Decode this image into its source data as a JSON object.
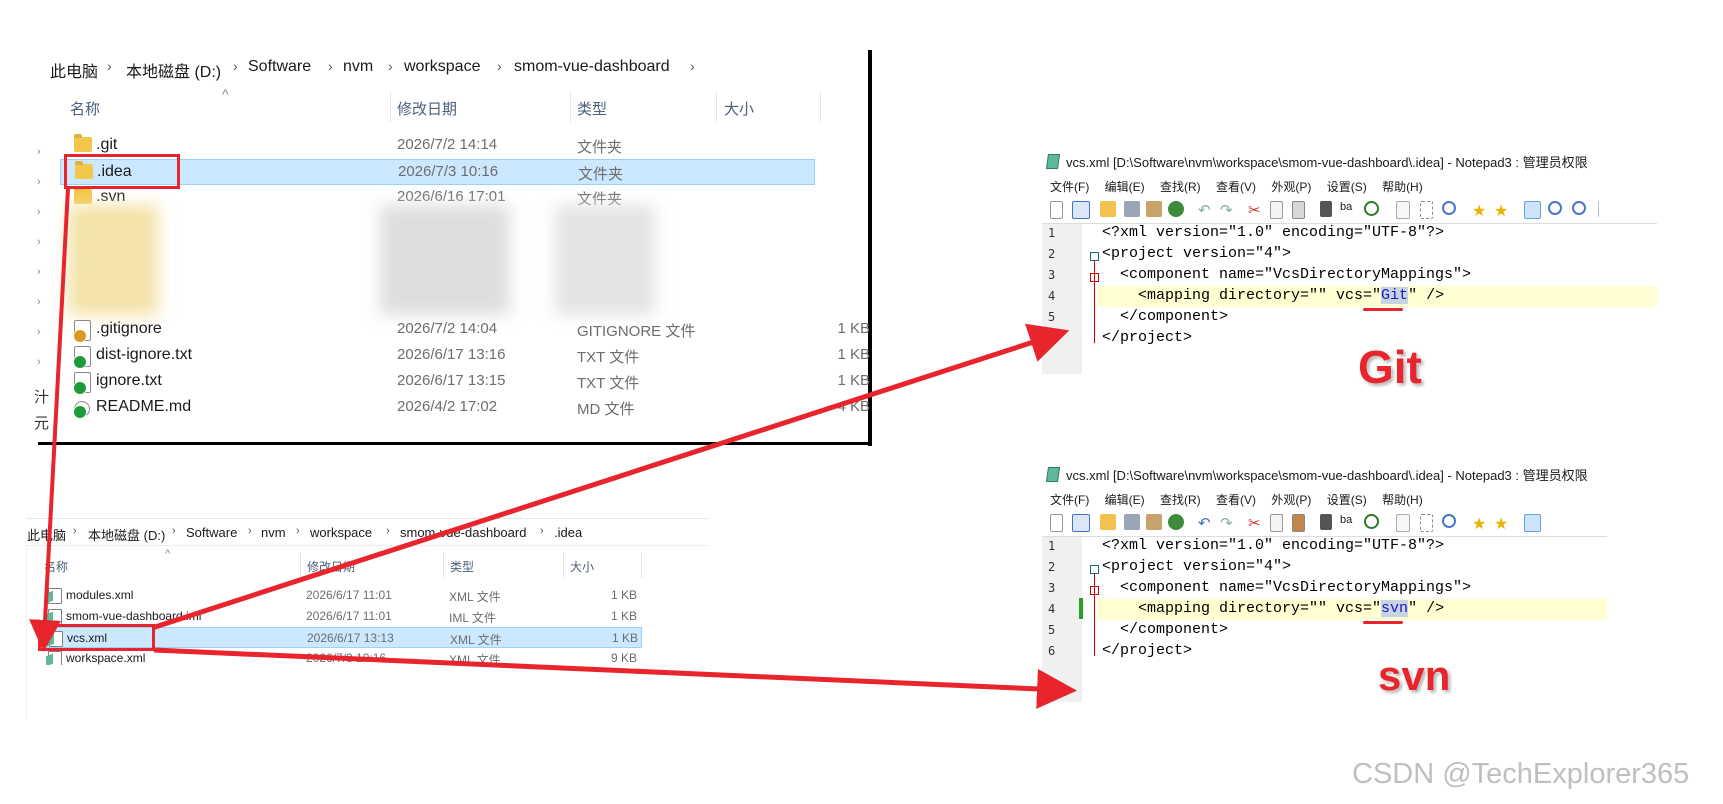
{
  "explorer1": {
    "breadcrumb": [
      "此电脑",
      "本地磁盘 (D:)",
      "Software",
      "nvm",
      "workspace",
      "smom-vue-dashboard"
    ],
    "columns": [
      "名称",
      "修改日期",
      "类型",
      "大小"
    ],
    "rows": [
      {
        "name": ".git",
        "date": "2026/7/2 14:14",
        "type": "文件夹",
        "size": ""
      },
      {
        "name": ".idea",
        "date": "2026/7/3 10:16",
        "type": "文件夹",
        "size": ""
      },
      {
        "name": ".svn",
        "date": "2026/6/16 17:01",
        "type": "文件夹",
        "size": ""
      },
      {
        "name": ".gitignore",
        "date": "2026/7/2 14:04",
        "type": "GITIGNORE 文件",
        "size": "1 KB"
      },
      {
        "name": "dist-ignore.txt",
        "date": "2026/6/17 13:16",
        "type": "TXT 文件",
        "size": "1 KB"
      },
      {
        "name": "ignore.txt",
        "date": "2026/6/17 13:15",
        "type": "TXT 文件",
        "size": "1 KB"
      },
      {
        "name": "README.md",
        "date": "2026/4/2 17:02",
        "type": "MD 文件",
        "size": "4 KB"
      }
    ]
  },
  "explorer2": {
    "breadcrumb": [
      "此电脑",
      "本地磁盘 (D:)",
      "Software",
      "nvm",
      "workspace",
      "smom-vue-dashboard",
      ".idea"
    ],
    "columns": [
      "名称",
      "修改日期",
      "类型",
      "大小"
    ],
    "rows": [
      {
        "name": "modules.xml",
        "date": "2026/6/17 11:01",
        "type": "XML 文件",
        "size": "1 KB"
      },
      {
        "name": "smom-vue-dashboard.iml",
        "date": "2026/6/17 11:01",
        "type": "IML 文件",
        "size": "1 KB"
      },
      {
        "name": "vcs.xml",
        "date": "2026/6/17 13:13",
        "type": "XML 文件",
        "size": "1 KB"
      },
      {
        "name": "workspace.xml",
        "date": "2026/7/3 10:16",
        "type": "XML 文件",
        "size": "9 KB"
      }
    ]
  },
  "notepad": {
    "title": "vcs.xml [D:\\Software\\nvm\\workspace\\smom-vue-dashboard\\.idea] - Notepad3 : 管理员权限",
    "menu": [
      "文件(F)",
      "编辑(E)",
      "查找(R)",
      "查看(V)",
      "外观(P)",
      "设置(S)",
      "帮助(H)"
    ],
    "line_numbers": [
      "1",
      "2",
      "3",
      "4",
      "5",
      "6"
    ],
    "xml_decl": "<?xml version=\"1.0\" encoding=\"UTF-8\"?>",
    "project_open": "<project version=\"4\">",
    "component_open": "<component name=\"VcsDirectoryMappings\">",
    "mapping_prefix": "<mapping directory=\"\" vcs=\"",
    "mapping_suffix": "\" />",
    "component_close": "</component>",
    "project_close": "</project>"
  },
  "notepad_git": {
    "vcs_value": "Git",
    "caption": "Git"
  },
  "notepad_svn": {
    "vcs_value": "svn",
    "caption": "svn"
  },
  "watermark": "CSDN @TechExplorer365",
  "colors": {
    "annotation_red": "#e8242c",
    "selection_blue": "#cce8ff",
    "line_highlight": "#ffffd2"
  }
}
